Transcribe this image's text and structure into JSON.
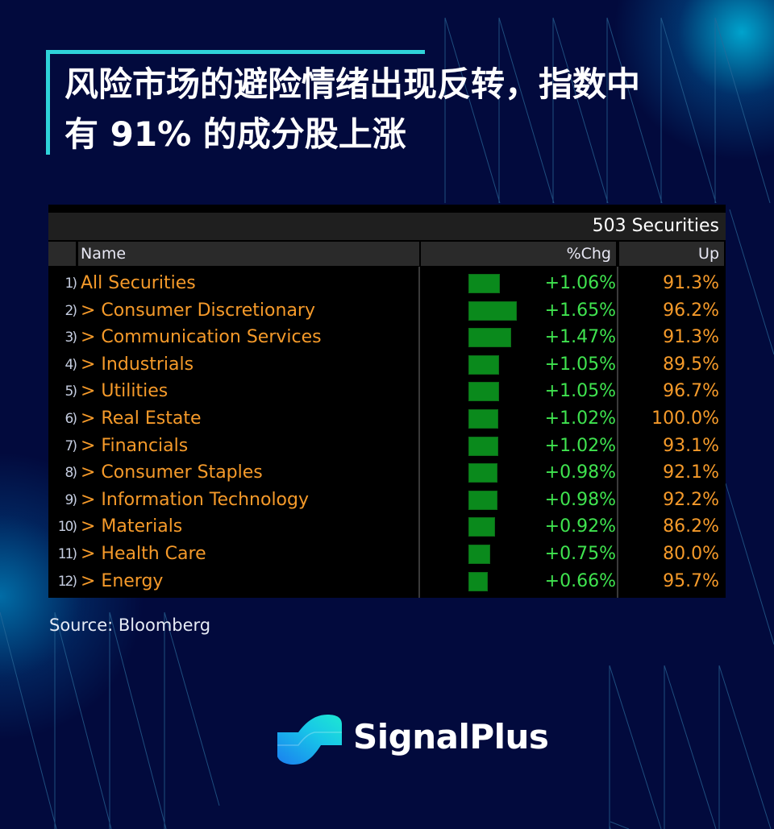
{
  "headline": {
    "line1": "风险市场的避险情绪出现反转，指数中",
    "line2": "有 91% 的成分股上涨"
  },
  "terminal": {
    "summary": "503 Securities",
    "columns": {
      "name": "Name",
      "chg": "%Chg",
      "up": "Up"
    },
    "rows": [
      {
        "index": "1)",
        "name": "All Securities",
        "chg": "+1.06%",
        "chg_value": 1.06,
        "up": "91.3%"
      },
      {
        "index": "2)",
        "name": "> Consumer Discretionary",
        "chg": "+1.65%",
        "chg_value": 1.65,
        "up": "96.2%"
      },
      {
        "index": "3)",
        "name": "> Communication Services",
        "chg": "+1.47%",
        "chg_value": 1.47,
        "up": "91.3%"
      },
      {
        "index": "4)",
        "name": "> Industrials",
        "chg": "+1.05%",
        "chg_value": 1.05,
        "up": "89.5%"
      },
      {
        "index": "5)",
        "name": "> Utilities",
        "chg": "+1.05%",
        "chg_value": 1.05,
        "up": "96.7%"
      },
      {
        "index": "6)",
        "name": "> Real Estate",
        "chg": "+1.02%",
        "chg_value": 1.02,
        "up": "100.0%"
      },
      {
        "index": "7)",
        "name": "> Financials",
        "chg": "+1.02%",
        "chg_value": 1.02,
        "up": "93.1%"
      },
      {
        "index": "8)",
        "name": "> Consumer Staples",
        "chg": "+0.98%",
        "chg_value": 0.98,
        "up": "92.1%"
      },
      {
        "index": "9)",
        "name": "> Information Technology",
        "chg": "+0.98%",
        "chg_value": 0.98,
        "up": "92.2%"
      },
      {
        "index": "10)",
        "name": "> Materials",
        "chg": "+0.92%",
        "chg_value": 0.92,
        "up": "86.2%"
      },
      {
        "index": "11)",
        "name": "> Health Care",
        "chg": "+0.75%",
        "chg_value": 0.75,
        "up": "80.0%"
      },
      {
        "index": "12)",
        "name": "> Energy",
        "chg": "+0.66%",
        "chg_value": 0.66,
        "up": "95.7%"
      }
    ],
    "colors": {
      "name": "#f59a2a",
      "chg": "#3fe34f",
      "bar": "#0a8a1c",
      "up": "#f59a2a"
    }
  },
  "source": "Source: Bloomberg",
  "brand": {
    "name": "SignalPlus",
    "logo_icon": "signalplus-wave-logo"
  },
  "theme": {
    "background": "#020a3d",
    "accent": "#2fd3d9"
  }
}
